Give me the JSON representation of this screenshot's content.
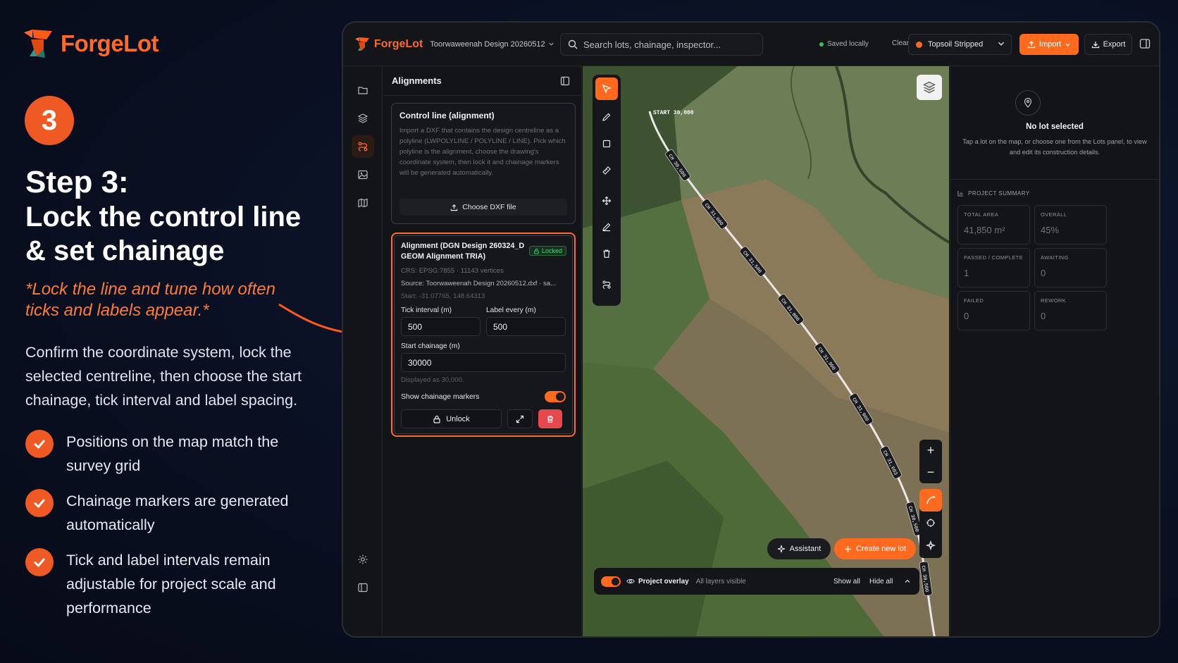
{
  "promo": {
    "brand": "ForgeLot",
    "step_number": "3",
    "step_title": "Step 3:",
    "step_subtitle": "Lock the control line & set chainage",
    "note": "*Lock the line and tune how often ticks and labels appear.*",
    "description": "Confirm the coordinate system, lock the selected centreline, then choose the start chainage, tick interval and label spacing.",
    "checks": [
      "Positions on the map match the survey grid",
      "Chainage markers are generated automatically",
      "Tick and label intervals remain adjustable for project scale and performance"
    ]
  },
  "topbar": {
    "brand": "ForgeLot",
    "project": "Toorwaweenah Design 20260512",
    "search_placeholder": "Search lots, chainage, inspector...",
    "saved_status": "Saved locally",
    "clear_label": "Clear",
    "stage": "Topsoil Stripped",
    "import_label": "Import",
    "export_label": "Export"
  },
  "alignments": {
    "header": "Alignments",
    "control_card": {
      "title": "Control line (alignment)",
      "description": "Import a DXF that contains the design centreline as a polyline (LWPOLYLINE / POLYLINE / LINE). Pick which polyline is the alignment, choose the drawing's coordinate system, then lock it and chainage markers will be generated automatically.",
      "choose_button": "Choose DXF file"
    },
    "alignment_card": {
      "title": "Alignment (DGN Design 260324_D GEOM Alignment TRIA)",
      "badge": "Locked",
      "crs": "CRS: EPSG:7855 · 11143 vertices",
      "source": "Source: Toorwaweenah Design 20260512.dxf · sa...",
      "start": "Start: -31.07765, 148.64313",
      "tick_interval_label": "Tick interval (m)",
      "tick_interval_value": "500",
      "label_every_label": "Label every (m)",
      "label_every_value": "500",
      "start_chainage_label": "Start chainage (m)",
      "start_chainage_value": "30000",
      "displayed_as": "Displayed as 30,000.",
      "show_markers_label": "Show chainage markers",
      "show_markers_on": true,
      "unlock_label": "Unlock"
    }
  },
  "map": {
    "start_label": "START 30,000",
    "chainage_labels": [
      "CH 30,500",
      "CH 31,000",
      "CH 31,500",
      "CH 31,800",
      "CH 31,900",
      "CH 31,900",
      "CH 31,603",
      "CH 30,500",
      "CH 30,500"
    ],
    "assistant_label": "Assistant",
    "create_lot_label": "Create new lot",
    "overlay_label": "Project overlay",
    "overlay_status": "All layers visible",
    "show_all": "Show all",
    "hide_all": "Hide all"
  },
  "right_panel": {
    "no_lot_title": "No lot selected",
    "no_lot_desc": "Tap a lot on the map, or choose one from the Lots panel, to view and edit its construction details.",
    "summary_title": "PROJECT SUMMARY",
    "stats": [
      {
        "label": "TOTAL AREA",
        "value": "41,850 m²"
      },
      {
        "label": "OVERALL",
        "value": "45%"
      },
      {
        "label": "PASSED / COMPLETE",
        "value": "1"
      },
      {
        "label": "AWAITING",
        "value": "0"
      },
      {
        "label": "FAILED",
        "value": "0"
      },
      {
        "label": "REWORK",
        "value": "0"
      }
    ]
  },
  "colors": {
    "accent": "#ff6a1f",
    "danger": "#e5484d",
    "success": "#4cd07d"
  }
}
